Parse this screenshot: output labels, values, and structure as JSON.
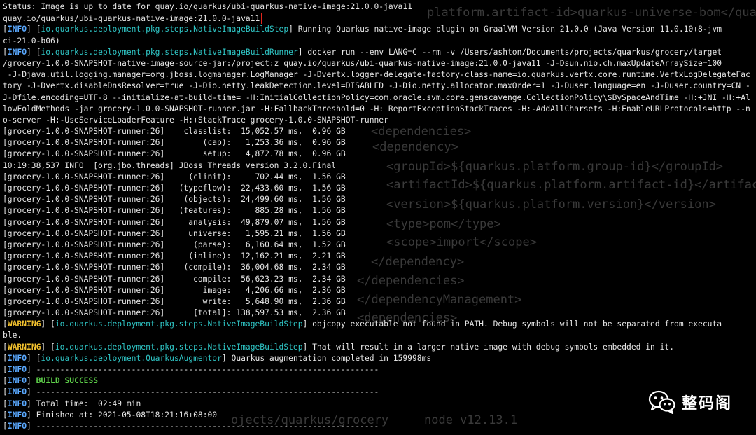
{
  "background_xml": [
    "platform.artifact-id>quarkus-universe-bom</quar",
    "<dependencies>",
    "<dependency>",
    "<groupId>${quarkus.platform.group-id}</groupId>",
    "<artifactId>${quarkus.platform.artifact-id}</artifac",
    "<version>${quarkus.platform.version}</version>",
    "<type>pom</type>",
    "<scope>import</scope>",
    "</dependency>",
    "</dependencies>",
    "</dependencyManagement>",
    "<dependencies>",
    "ojects/quarkus/grocery",
    "node v12.13.1"
  ],
  "lines": [
    {
      "text": "Status: Image is up to date for quay.io/quarkus/ubi-quarkus-native-image:21.0.0-java11"
    },
    {
      "text": "quay.io/quarkus/ubi-quarkus-native-image:21.0.0-java11",
      "boxed": true
    },
    {
      "level": "INFO",
      "cls": "io.quarkus.deployment.pkg.steps.NativeImageBuildStep",
      "text": " Running Quarkus native-image plugin on GraalVM Version 21.0.0 (Java Version 11.0.10+8-jvm"
    },
    {
      "text": "ci-21.0-b06)"
    },
    {
      "level": "INFO",
      "cls": "io.quarkus.deployment.pkg.steps.NativeImageBuildRunner",
      "text": " docker run --env LANG=C --rm -v /Users/ashton/Documents/projects/quarkus/grocery/target"
    },
    {
      "text": "/grocery-1.0.0-SNAPSHOT-native-image-source-jar:/project:z quay.io/quarkus/ubi-quarkus-native-image:21.0.0-java11 -J-Dsun.nio.ch.maxUpdateArraySize=100"
    },
    {
      "text": " -J-Djava.util.logging.manager=org.jboss.logmanager.LogManager -J-Dvertx.logger-delegate-factory-class-name=io.quarkus.vertx.core.runtime.VertxLogDelegateFactory -J-Dvertx.disableDnsResolver=true -J-Dio.netty.leakDetection.level=DISABLED -J-Dio.netty.allocator.maxOrder=1 -J-Duser.language=en -J-Duser.country=CN -J-Dfile.encoding=UTF-8 --initialize-at-build-time= -H:InitialCollectionPolicy=com.oracle.svm.core.genscavenge.CollectionPolicy\\$BySpaceAndTime -H:+JNI -H:+AllowFoldMethods -jar grocery-1.0.0-SNAPSHOT-runner.jar -H:FallbackThreshold=0 -H:+ReportExceptionStackTraces -H:-AddAllCharsets -H:EnableURLProtocols=http --no-server -H:-UseServiceLoaderFeature -H:+StackTrace grocery-1.0.0-SNAPSHOT-runner",
      "wrap": true
    },
    {
      "text": "[grocery-1.0.0-SNAPSHOT-runner:26]    classlist:  15,052.57 ms,  0.96 GB"
    },
    {
      "text": "[grocery-1.0.0-SNAPSHOT-runner:26]        (cap):   1,253.36 ms,  0.96 GB"
    },
    {
      "text": "[grocery-1.0.0-SNAPSHOT-runner:26]        setup:   4,872.78 ms,  0.96 GB"
    },
    {
      "text": "10:19:38,537 INFO  [org.jbo.threads] JBoss Threads version 3.2.0.Final"
    },
    {
      "text": "[grocery-1.0.0-SNAPSHOT-runner:26]     (clinit):     702.44 ms,  1.56 GB"
    },
    {
      "text": "[grocery-1.0.0-SNAPSHOT-runner:26]   (typeflow):  22,433.60 ms,  1.56 GB"
    },
    {
      "text": "[grocery-1.0.0-SNAPSHOT-runner:26]    (objects):  24,499.60 ms,  1.56 GB"
    },
    {
      "text": "[grocery-1.0.0-SNAPSHOT-runner:26]   (features):     885.28 ms,  1.56 GB"
    },
    {
      "text": "[grocery-1.0.0-SNAPSHOT-runner:26]     analysis:  49,879.07 ms,  1.56 GB"
    },
    {
      "text": "[grocery-1.0.0-SNAPSHOT-runner:26]     universe:   1,595.21 ms,  1.56 GB"
    },
    {
      "text": "[grocery-1.0.0-SNAPSHOT-runner:26]      (parse):   6,160.64 ms,  1.52 GB"
    },
    {
      "text": "[grocery-1.0.0-SNAPSHOT-runner:26]     (inline):  12,162.21 ms,  2.21 GB"
    },
    {
      "text": "[grocery-1.0.0-SNAPSHOT-runner:26]    (compile):  36,004.68 ms,  2.34 GB"
    },
    {
      "text": "[grocery-1.0.0-SNAPSHOT-runner:26]      compile:  56,623.23 ms,  2.34 GB"
    },
    {
      "text": "[grocery-1.0.0-SNAPSHOT-runner:26]        image:   4,206.66 ms,  2.36 GB"
    },
    {
      "text": "[grocery-1.0.0-SNAPSHOT-runner:26]        write:   5,648.90 ms,  2.36 GB"
    },
    {
      "text": "[grocery-1.0.0-SNAPSHOT-runner:26]      [total]: 138,597.53 ms,  2.36 GB"
    },
    {
      "level": "WARNING",
      "cls": "io.quarkus.deployment.pkg.steps.NativeImageBuildStep",
      "text": " objcopy executable not found in PATH. Debug symbols will not be separated from executa"
    },
    {
      "text": "ble."
    },
    {
      "level": "WARNING",
      "cls": "io.quarkus.deployment.pkg.steps.NativeImageBuildStep",
      "text": " That will result in a larger native image with debug symbols embedded in it."
    },
    {
      "level": "INFO",
      "cls": "io.quarkus.deployment.QuarkusAugmentor",
      "text": " Quarkus augmentation completed in 159998ms"
    },
    {
      "level": "INFO",
      "text": " ------------------------------------------------------------------------"
    },
    {
      "level": "INFO",
      "success": "BUILD SUCCESS",
      "text": ""
    },
    {
      "level": "INFO",
      "text": " ------------------------------------------------------------------------"
    },
    {
      "level": "INFO",
      "text": " Total time:  02:49 min"
    },
    {
      "level": "INFO",
      "text": " Finished at: 2021-05-08T18:21:16+08:00"
    },
    {
      "level": "INFO",
      "text": " ------------------------------------------------------------------------"
    }
  ],
  "watermark": {
    "text": "整码阁",
    "icon": "wechat-icon"
  }
}
